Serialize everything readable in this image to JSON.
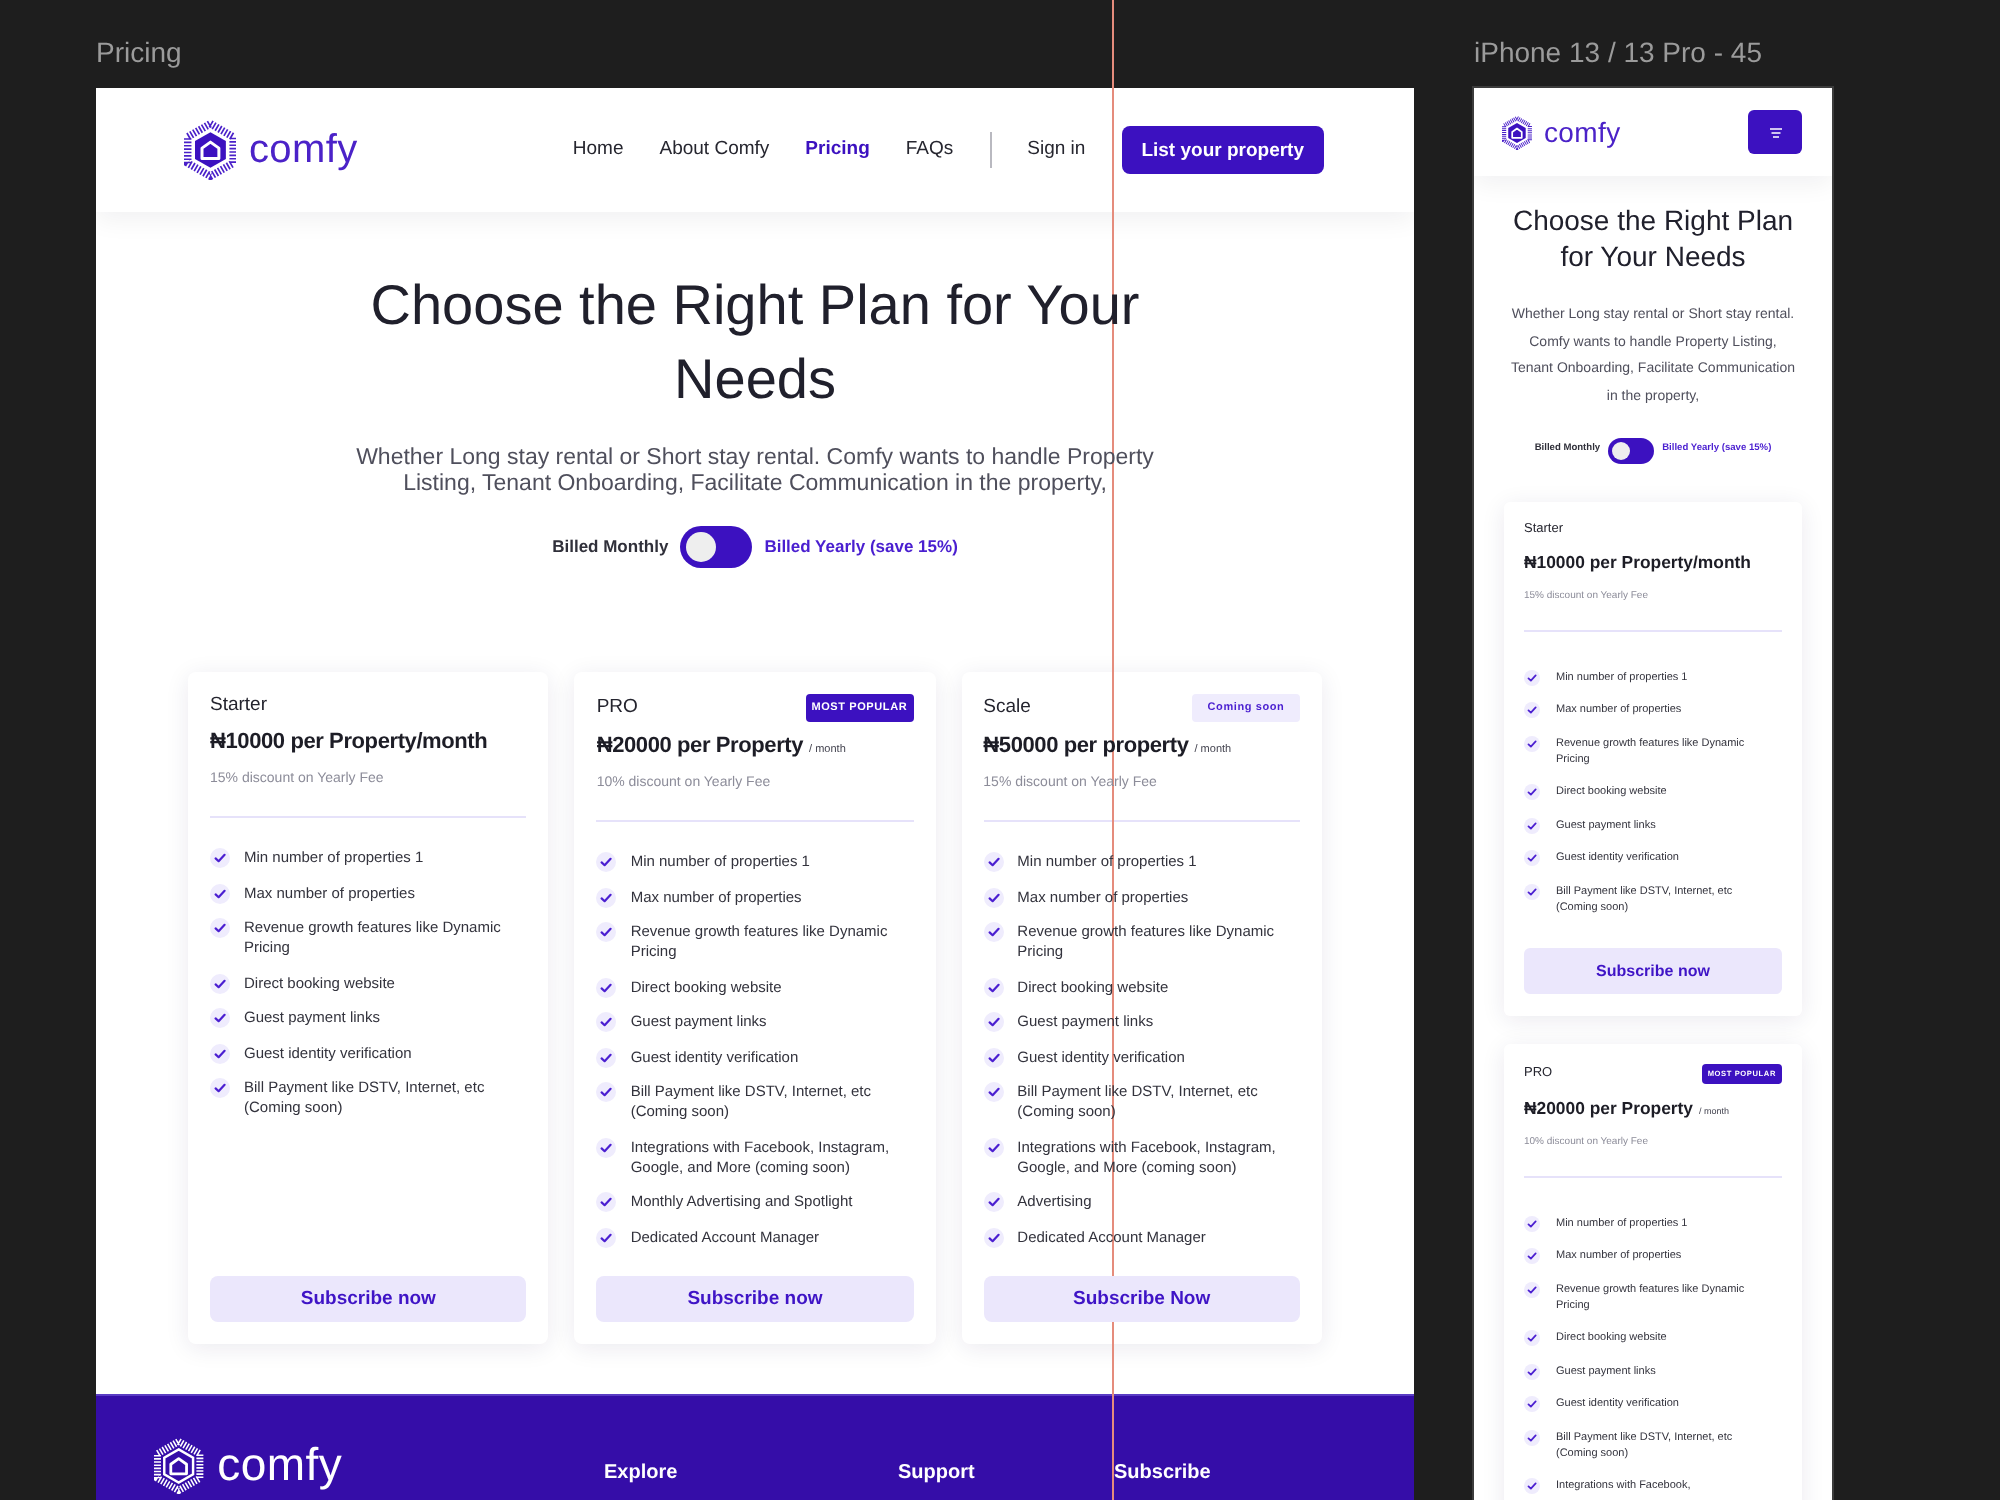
{
  "desktop": {
    "frame_label": "Pricing",
    "header": {
      "logo": "comfy",
      "nav": [
        {
          "label": "Home",
          "selected": false
        },
        {
          "label": "About Comfy",
          "selected": false
        },
        {
          "label": "Pricing",
          "selected": true
        },
        {
          "label": "FAQs",
          "selected": false
        }
      ],
      "sign_in": "Sign in",
      "cta": "List your property"
    },
    "hero": {
      "title": "Choose the Right Plan for Your Needs",
      "subtitle": "Whether Long stay rental or Short stay rental. Comfy wants to handle Property Listing, Tenant Onboarding, Facilitate Communication in the property,",
      "billing_options": [
        {
          "label": "Billed Monthly",
          "selected": false
        },
        {
          "label": "Billed Yearly (save 15%)",
          "selected": true
        }
      ],
      "billing_toggle": {
        "on": false
      }
    },
    "plans": [
      {
        "name": "Starter",
        "price": "₦10000 per Property/month",
        "discount": "15% discount on Yearly Fee",
        "features": [
          "Min number of properties 1",
          "Max number of properties",
          "Revenue growth features like Dynamic Pricing",
          "Direct booking website",
          "Guest payment links",
          "Guest identity verification",
          "Bill Payment like DSTV, Internet, etc (Coming soon)"
        ],
        "button": "Subscribe now"
      },
      {
        "name": "PRO",
        "badge": {
          "label": "MOST POPULAR",
          "kind": "solid"
        },
        "price": "₦20000 per Property",
        "period": "/ month",
        "discount": "10% discount on Yearly Fee",
        "features": [
          "Min number of properties 1",
          "Max number of properties",
          "Revenue growth features like Dynamic Pricing",
          "Direct booking website",
          "Guest payment links",
          "Guest identity verification",
          "Bill Payment like DSTV, Internet, etc (Coming soon)",
          "Integrations with Facebook, Instagram, Google, and More (coming soon)",
          "Monthly Advertising and Spotlight",
          "Dedicated Account Manager"
        ],
        "button": "Subscribe now"
      },
      {
        "name": "Scale",
        "badge": {
          "label": "Coming soon",
          "kind": "soft"
        },
        "price": "₦50000 per property",
        "period": "/ month",
        "discount": "15% discount on Yearly Fee",
        "features": [
          "Min number of properties 1",
          "Max number of properties",
          "Revenue growth features like Dynamic Pricing",
          "Direct booking website",
          "Guest payment links",
          "Guest identity verification",
          "Bill Payment like DSTV, Internet, etc (Coming soon)",
          "Integrations with Facebook, Instagram, Google, and More (coming soon)",
          "Advertising",
          "Dedicated Account Manager"
        ],
        "button": "Subscribe Now"
      }
    ],
    "footer": {
      "logo": "comfy",
      "columns": [
        "Explore",
        "Support",
        "Subscribe"
      ]
    }
  },
  "mobile": {
    "frame_label": "iPhone 13 / 13 Pro - 45",
    "header": {
      "logo": "comfy"
    },
    "hero": {
      "title": "Choose the Right Plan for Your Needs",
      "subtitle": "Whether Long stay rental or Short stay rental. Comfy wants to handle Property Listing, Tenant Onboarding, Facilitate Communication in the property,",
      "billing_options": [
        {
          "label": "Billed Monthly",
          "selected": false
        },
        {
          "label": "Billed Yearly (save 15%)",
          "selected": true
        }
      ],
      "billing_toggle": {
        "on": false
      }
    },
    "plans": [
      {
        "name": "Starter",
        "price": "₦10000 per Property/month",
        "discount": "15% discount on Yearly Fee",
        "features": [
          "Min number of properties 1",
          "Max number of properties",
          "Revenue growth features like Dynamic Pricing",
          "Direct booking website",
          "Guest payment links",
          "Guest identity verification",
          "Bill Payment like DSTV, Internet, etc (Coming soon)"
        ],
        "button": "Subscribe now"
      },
      {
        "name": "PRO",
        "badge": {
          "label": "MOST POPULAR",
          "kind": "solid"
        },
        "price": "₦20000 per Property",
        "period": "/ month",
        "discount": "10% discount on Yearly Fee",
        "features": [
          "Min number of properties 1",
          "Max number of properties",
          "Revenue growth features like Dynamic Pricing",
          "Direct booking website",
          "Guest payment links",
          "Guest identity verification",
          "Bill Payment like DSTV, Internet, etc (Coming soon)",
          "Integrations with Facebook,"
        ]
      }
    ]
  }
}
